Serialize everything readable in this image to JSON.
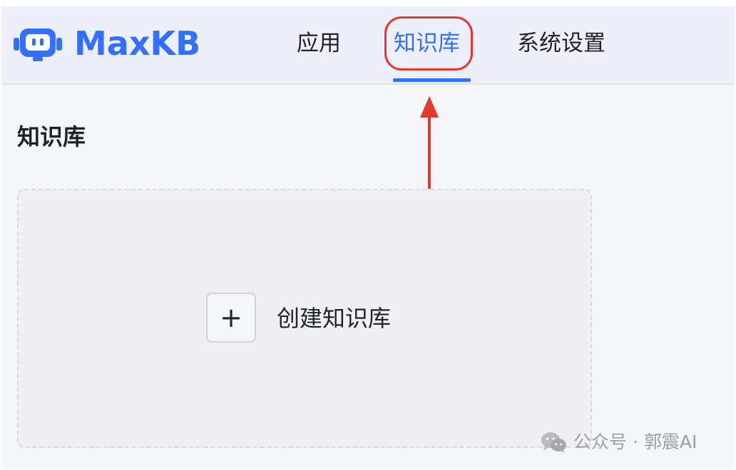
{
  "brand": {
    "name": "MaxKB",
    "logo_icon": "robot-icon",
    "color": "#3370ff"
  },
  "nav": {
    "items": [
      {
        "label": "应用",
        "active": false
      },
      {
        "label": "知识库",
        "active": true
      },
      {
        "label": "系统设置",
        "active": false
      }
    ],
    "active_color": "#3370ff"
  },
  "annotation": {
    "highlight_color": "#e2382d",
    "arrow_icon": "arrow-up-icon"
  },
  "page": {
    "title": "知识库"
  },
  "create_card": {
    "icon": "plus-icon",
    "plus_glyph": "+",
    "label": "创建知识库"
  },
  "watermark": {
    "icon": "wechat-icon",
    "text": "公众号 · 郭震AI"
  }
}
